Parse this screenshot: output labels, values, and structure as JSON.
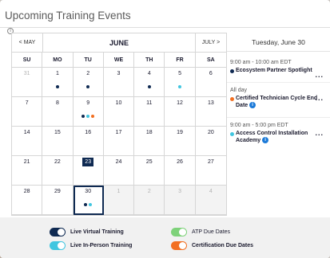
{
  "widget": {
    "title": "Upcoming Training Events"
  },
  "calendar": {
    "prev": "< MAY",
    "month": "JUNE",
    "next": "JULY >",
    "weekdays": [
      "SU",
      "MO",
      "TU",
      "WE",
      "TH",
      "FR",
      "SA"
    ],
    "days": [
      {
        "n": "31",
        "muted": true,
        "dots": []
      },
      {
        "n": "1",
        "dots": [
          "#0f2a52"
        ]
      },
      {
        "n": "2",
        "dots": [
          "#0f2a52"
        ]
      },
      {
        "n": "3",
        "dots": []
      },
      {
        "n": "4",
        "dots": [
          "#0f2a52"
        ]
      },
      {
        "n": "5",
        "dots": [
          "#41c6e0"
        ]
      },
      {
        "n": "6",
        "dots": []
      },
      {
        "n": "7",
        "dots": []
      },
      {
        "n": "8",
        "dots": []
      },
      {
        "n": "9",
        "dots": [
          "#0f2a52",
          "#41c6e0",
          "#f26f21"
        ]
      },
      {
        "n": "10",
        "dots": []
      },
      {
        "n": "11",
        "dots": []
      },
      {
        "n": "12",
        "dots": []
      },
      {
        "n": "13",
        "dots": []
      },
      {
        "n": "14",
        "dots": []
      },
      {
        "n": "15",
        "dots": []
      },
      {
        "n": "16",
        "dots": []
      },
      {
        "n": "17",
        "dots": []
      },
      {
        "n": "18",
        "dots": []
      },
      {
        "n": "19",
        "dots": []
      },
      {
        "n": "20",
        "dots": []
      },
      {
        "n": "21",
        "dots": []
      },
      {
        "n": "22",
        "dots": []
      },
      {
        "n": "23",
        "today": true,
        "dots": []
      },
      {
        "n": "24",
        "dots": []
      },
      {
        "n": "25",
        "dots": []
      },
      {
        "n": "26",
        "dots": []
      },
      {
        "n": "27",
        "dots": []
      },
      {
        "n": "28",
        "dots": []
      },
      {
        "n": "29",
        "dots": []
      },
      {
        "n": "30",
        "selected": true,
        "dots": [
          "#0f2a52",
          "#41c6e0"
        ]
      },
      {
        "n": "1",
        "muted": true,
        "shade": true,
        "dots": []
      },
      {
        "n": "2",
        "muted": true,
        "shade": true,
        "dots": []
      },
      {
        "n": "3",
        "muted": true,
        "shade": true,
        "dots": []
      },
      {
        "n": "4",
        "muted": true,
        "shade": true,
        "dots": []
      }
    ]
  },
  "events_panel": {
    "date": "Tuesday, June 30",
    "events": [
      {
        "time": "9:00 am - 10:00 am EDT",
        "name": "Ecosystem Partner Spotlight",
        "color": "#0f2a52",
        "info": false,
        "more": "..."
      },
      {
        "time": "All day",
        "name": "Certified Technician Cycle End Date",
        "color": "#f26f21",
        "info": true,
        "more": "..."
      },
      {
        "time": "9:00 am - 5:00 pm EDT",
        "name": "Access Control Installation Academy",
        "color": "#41c6e0",
        "info": true,
        "more": "..."
      }
    ]
  },
  "legend": [
    {
      "label": "Live Virtual Training",
      "color": "#0f2a52"
    },
    {
      "label": "Live In-Person Training",
      "color": "#41c6e0"
    },
    {
      "label": "ATP Due Dates",
      "color": "#7ed27a"
    },
    {
      "label": "Certification Due Dates",
      "color": "#f26f21"
    }
  ]
}
